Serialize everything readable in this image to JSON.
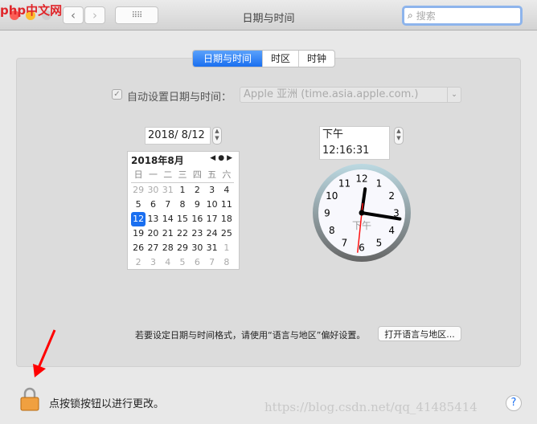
{
  "window": {
    "title": "日期与时间",
    "search_placeholder": "搜索",
    "watermark_logo": "php中文网"
  },
  "tabs": [
    {
      "label": "日期与时间",
      "active": true
    },
    {
      "label": "时区"
    },
    {
      "label": "时钟"
    }
  ],
  "auto": {
    "checked": true,
    "label": "自动设置日期与时间：",
    "server": "Apple 亚洲 (time.asia.apple.com.)"
  },
  "date_field": "2018/  8/12",
  "time_field": "下午12:16:31",
  "calendar": {
    "header": "2018年8月",
    "weekdays": [
      "日",
      "一",
      "二",
      "三",
      "四",
      "五",
      "六"
    ],
    "days": [
      [
        "29",
        "30",
        "31",
        "1",
        "2",
        "3",
        "4"
      ],
      [
        "5",
        "6",
        "7",
        "8",
        "9",
        "10",
        "11"
      ],
      [
        "12",
        "13",
        "14",
        "15",
        "16",
        "17",
        "18"
      ],
      [
        "19",
        "20",
        "21",
        "22",
        "23",
        "24",
        "25"
      ],
      [
        "26",
        "27",
        "28",
        "29",
        "30",
        "31",
        "1"
      ],
      [
        "2",
        "3",
        "4",
        "5",
        "6",
        "7",
        "8"
      ]
    ],
    "selected": "12"
  },
  "clock": {
    "ampm": "下午",
    "hour": 12,
    "minute": 16,
    "second": 31,
    "numbers": [
      "12",
      "1",
      "2",
      "3",
      "4",
      "5",
      "6",
      "7",
      "8",
      "9",
      "10",
      "11"
    ]
  },
  "format_hint": "若要设定日期与时间格式，请使用“语言与地区”偏好设置。",
  "open_region_button": "打开语言与地区...",
  "lock_text": "点按锁按钮以进行更改。",
  "help": "?",
  "watermark": "https://blog.csdn.net/qq_41485414"
}
